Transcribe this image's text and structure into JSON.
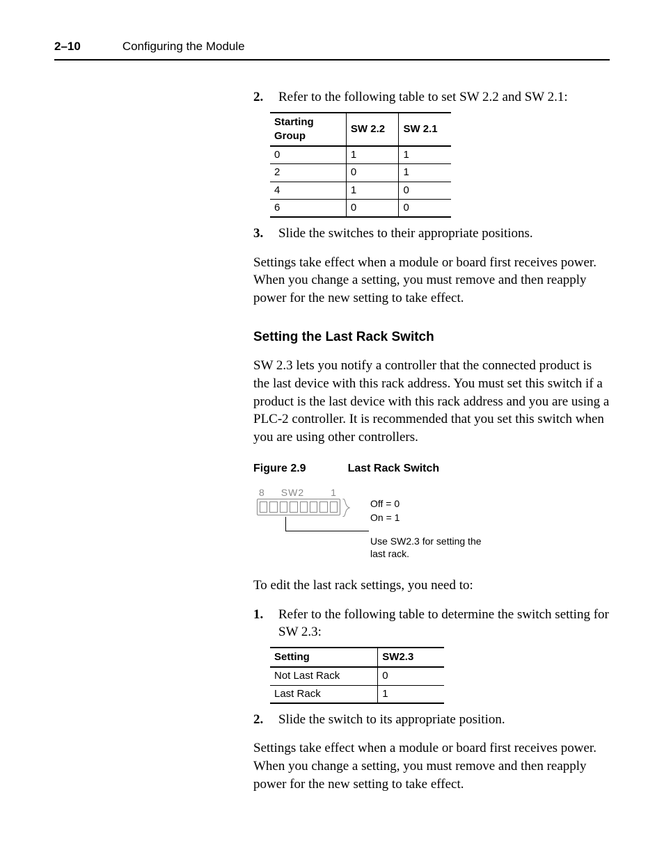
{
  "header": {
    "page_number": "2–10",
    "chapter_title": "Configuring the Module"
  },
  "step2_intro": "Refer to the following table to set SW 2.2 and SW 2.1:",
  "step2_num": "2.",
  "table1": {
    "headers": [
      "Starting Group",
      "SW 2.2",
      "SW 2.1"
    ],
    "rows": [
      [
        "0",
        "1",
        "1"
      ],
      [
        "2",
        "0",
        "1"
      ],
      [
        "4",
        "1",
        "0"
      ],
      [
        "6",
        "0",
        "0"
      ]
    ]
  },
  "step3_num": "3.",
  "step3_text": "Slide the switches to their appropriate positions.",
  "para_power1": "Settings take effect when a module or board first receives power. When you change a setting, you must remove and then reapply power for the new setting to take effect.",
  "subheading": "Setting the Last Rack Switch",
  "sw23_para": "SW 2.3 lets you notify a controller that the connected product is the last device with this rack address. You must set this switch if a product is the last device with this rack address and you are using a PLC-2 controller. It is recommended that you set this switch when you are using other controllers.",
  "figure": {
    "label": "Figure 2.9",
    "title": "Last Rack Switch",
    "dip_left": "8",
    "dip_mid": "SW2",
    "dip_right": "1",
    "legend_off": "Off = 0",
    "legend_on": "On = 1",
    "callout": "Use SW2.3 for setting the last rack."
  },
  "edit_intro": "To edit the last rack settings, you need to:",
  "step1b_num": "1.",
  "step1b_text": "Refer to the following table to determine the switch setting for SW 2.3:",
  "table2": {
    "headers": [
      "Setting",
      "SW2.3"
    ],
    "rows": [
      [
        "Not Last Rack",
        "0"
      ],
      [
        "Last Rack",
        "1"
      ]
    ]
  },
  "step2b_num": "2.",
  "step2b_text": "Slide the switch to its appropriate position.",
  "para_power2": "Settings take effect when a module or board first receives power. When you change a setting, you must remove and then reapply power for the new setting to take effect."
}
